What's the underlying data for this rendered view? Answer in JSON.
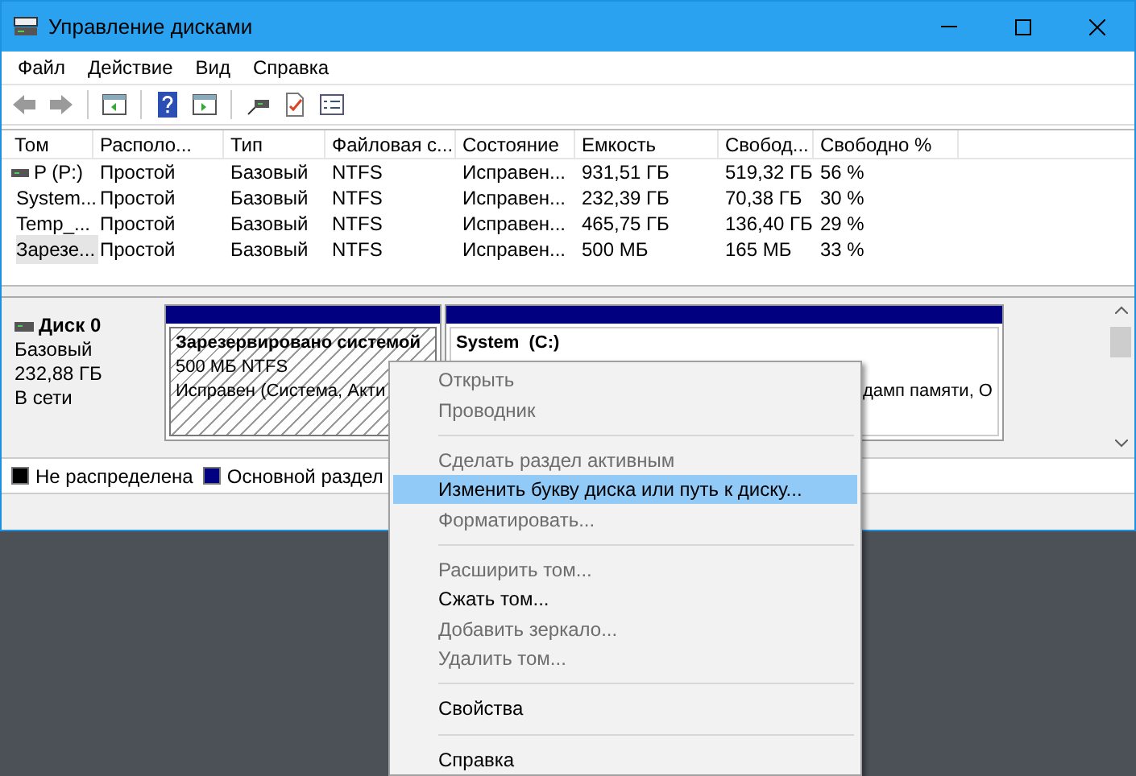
{
  "window": {
    "title": "Управление дисками"
  },
  "menu": [
    "Файл",
    "Действие",
    "Вид",
    "Справка"
  ],
  "toolbar": [
    {
      "kind": "back"
    },
    {
      "kind": "forward"
    },
    {
      "kind": "sep"
    },
    {
      "kind": "panel"
    },
    {
      "kind": "sep"
    },
    {
      "kind": "help"
    },
    {
      "kind": "panel2"
    },
    {
      "kind": "sep"
    },
    {
      "kind": "connect"
    },
    {
      "kind": "check"
    },
    {
      "kind": "props"
    }
  ],
  "table": {
    "columns": [
      "Том",
      "Располо...",
      "Тип",
      "Файловая с...",
      "Состояние",
      "Емкость",
      "Свобод...",
      "Свободно %"
    ],
    "rows": [
      {
        "selected": false,
        "cells": [
          "P (P:)",
          "Простой",
          "Базовый",
          "NTFS",
          "Исправен...",
          "931,51 ГБ",
          "519,32 ГБ",
          "56 %"
        ]
      },
      {
        "selected": false,
        "cells": [
          "System...",
          "Простой",
          "Базовый",
          "NTFS",
          "Исправен...",
          "232,39 ГБ",
          "70,38 ГБ",
          "30 %"
        ]
      },
      {
        "selected": false,
        "cells": [
          "Temp_...",
          "Простой",
          "Базовый",
          "NTFS",
          "Исправен...",
          "465,75 ГБ",
          "136,40 ГБ",
          "29 %"
        ]
      },
      {
        "selected": true,
        "cells": [
          "Зарезе...",
          "Простой",
          "Базовый",
          "NTFS",
          "Исправен...",
          "500 МБ",
          "165 МБ",
          "33 %"
        ]
      }
    ]
  },
  "disk": {
    "name": "Диск 0",
    "type": "Базовый",
    "size": "232,88 ГБ",
    "status": "В сети",
    "partitions": [
      {
        "selected": true,
        "title": "Зарезервировано системой",
        "lines": [
          "500 МБ NTFS",
          "Исправен (Система, Акти"
        ]
      },
      {
        "selected": false,
        "title": "System  (C:)",
        "lines": [
          "дамп памяти, О"
        ]
      }
    ]
  },
  "legend": [
    {
      "label": "Не распределена",
      "color": "#000000"
    },
    {
      "label": "Основной раздел",
      "color": "#000080"
    }
  ],
  "context_menu": [
    {
      "kind": "item",
      "label": "Открыть",
      "disabled": true,
      "highlighted": false
    },
    {
      "kind": "item",
      "label": "Проводник",
      "disabled": true,
      "highlighted": false
    },
    {
      "kind": "separator"
    },
    {
      "kind": "item",
      "label": "Сделать раздел активным",
      "disabled": true,
      "highlighted": false
    },
    {
      "kind": "item",
      "label": "Изменить букву диска или путь к диску...",
      "disabled": false,
      "highlighted": true
    },
    {
      "kind": "item",
      "label": "Форматировать...",
      "disabled": true,
      "highlighted": false
    },
    {
      "kind": "separator"
    },
    {
      "kind": "item",
      "label": "Расширить том...",
      "disabled": true,
      "highlighted": false
    },
    {
      "kind": "item",
      "label": "Сжать том...",
      "disabled": false,
      "highlighted": false
    },
    {
      "kind": "item",
      "label": "Добавить зеркало...",
      "disabled": true,
      "highlighted": false
    },
    {
      "kind": "item",
      "label": "Удалить том...",
      "disabled": true,
      "highlighted": false
    },
    {
      "kind": "separator"
    },
    {
      "kind": "item",
      "label": "Свойства",
      "disabled": false,
      "highlighted": false
    },
    {
      "kind": "separator"
    },
    {
      "kind": "item",
      "label": "Справка",
      "disabled": false,
      "highlighted": false
    }
  ]
}
